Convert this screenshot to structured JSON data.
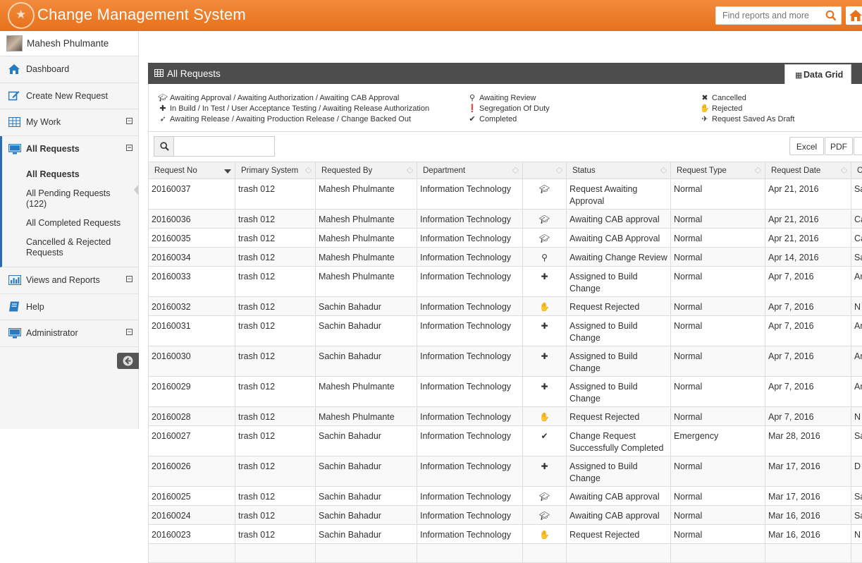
{
  "header": {
    "app_title": "Change Management System",
    "search_placeholder": "Find reports and more"
  },
  "user": {
    "name": "Mahesh Phulmante"
  },
  "sidebar": {
    "items": [
      {
        "label": "Dashboard",
        "icon": "home-icon"
      },
      {
        "label": "Create New Request",
        "icon": "edit-icon"
      },
      {
        "label": "My Work",
        "icon": "table-icon"
      },
      {
        "label": "All Requests",
        "icon": "monitor-icon"
      },
      {
        "label": "Views and Reports",
        "icon": "bar-chart-icon"
      },
      {
        "label": "Help",
        "icon": "book-icon"
      },
      {
        "label": "Administrator",
        "icon": "monitor-icon"
      }
    ],
    "sub_items": [
      "All Requests",
      "All Pending Requests (122)",
      "All Completed Requests",
      "Cancelled & Rejected Requests"
    ]
  },
  "panel": {
    "title": "All Requests",
    "tab_label": "Data Grid"
  },
  "legend": {
    "col1": [
      "Awaiting Approval / Awaiting Authorization / Awaiting CAB Approval",
      "In Build / In Test / User Acceptance Testing / Awaiting Release Authorization",
      "Awaiting Release / Awaiting Production Release / Change Backed Out"
    ],
    "col2": [
      "Awaiting Review",
      "Segregation Of Duty",
      "Completed"
    ],
    "col3": [
      "Cancelled",
      "Rejected",
      "Request Saved As Draft"
    ]
  },
  "toolbar": {
    "excel": "Excel",
    "pdf": "PDF"
  },
  "columns": [
    "Request No",
    "Primary System",
    "Requested By",
    "Department",
    "",
    "Status",
    "Request Type",
    "Request Date",
    "C"
  ],
  "rows": [
    {
      "no": "20160037",
      "system": "trash 012",
      "by": "Mahesh Phulmante",
      "dept": "Information Technology",
      "icon": "approval",
      "status": "Request Awaiting Approval",
      "type": "Normal",
      "date": "Apr 21, 2016",
      "c": "Sa"
    },
    {
      "no": "20160036",
      "system": "trash 012",
      "by": "Mahesh Phulmante",
      "dept": "Information Technology",
      "icon": "approval",
      "status": "Awaiting CAB approval",
      "type": "Normal",
      "date": "Apr 21, 2016",
      "c": "Ca"
    },
    {
      "no": "20160035",
      "system": "trash 012",
      "by": "Mahesh Phulmante",
      "dept": "Information Technology",
      "icon": "approval",
      "status": "Awaiting CAB Approval",
      "type": "Normal",
      "date": "Apr 21, 2016",
      "c": "Ca"
    },
    {
      "no": "20160034",
      "system": "trash 012",
      "by": "Mahesh Phulmante",
      "dept": "Information Technology",
      "icon": "review",
      "status": "Awaiting Change Review",
      "type": "Normal",
      "date": "Apr 14, 2016",
      "c": "Sa"
    },
    {
      "no": "20160033",
      "system": "trash 012",
      "by": "Mahesh Phulmante",
      "dept": "Information Technology",
      "icon": "build",
      "status": "Assigned to Build Change",
      "type": "Normal",
      "date": "Apr 7, 2016",
      "c": "Ar"
    },
    {
      "no": "20160032",
      "system": "trash 012",
      "by": "Sachin Bahadur",
      "dept": "Information Technology",
      "icon": "rejected",
      "status": "Request Rejected",
      "type": "Normal",
      "date": "Apr 7, 2016",
      "c": "N"
    },
    {
      "no": "20160031",
      "system": "trash 012",
      "by": "Sachin Bahadur",
      "dept": "Information Technology",
      "icon": "build",
      "status": "Assigned to Build Change",
      "type": "Normal",
      "date": "Apr 7, 2016",
      "c": "Ar"
    },
    {
      "no": "20160030",
      "system": "trash 012",
      "by": "Sachin Bahadur",
      "dept": "Information Technology",
      "icon": "build",
      "status": "Assigned to Build Change",
      "type": "Normal",
      "date": "Apr 7, 2016",
      "c": "Ar"
    },
    {
      "no": "20160029",
      "system": "trash 012",
      "by": "Mahesh Phulmante",
      "dept": "Information Technology",
      "icon": "build",
      "status": "Assigned to Build Change",
      "type": "Normal",
      "date": "Apr 7, 2016",
      "c": "Ar"
    },
    {
      "no": "20160028",
      "system": "trash 012",
      "by": "Mahesh Phulmante",
      "dept": "Information Technology",
      "icon": "rejected",
      "status": "Request Rejected",
      "type": "Normal",
      "date": "Apr 7, 2016",
      "c": "N"
    },
    {
      "no": "20160027",
      "system": "trash 012",
      "by": "Sachin Bahadur",
      "dept": "Information Technology",
      "icon": "completed",
      "status": "Change Request Successfully Completed",
      "type": "Emergency",
      "date": "Mar 28, 2016",
      "c": "Sa"
    },
    {
      "no": "20160026",
      "system": "trash 012",
      "by": "Sachin Bahadur",
      "dept": "Information Technology",
      "icon": "build",
      "status": "Assigned to Build Change",
      "type": "Normal",
      "date": "Mar 17, 2016",
      "c": "D"
    },
    {
      "no": "20160025",
      "system": "trash 012",
      "by": "Sachin Bahadur",
      "dept": "Information Technology",
      "icon": "approval",
      "status": "Awaiting CAB approval",
      "type": "Normal",
      "date": "Mar 17, 2016",
      "c": "Sa"
    },
    {
      "no": "20160024",
      "system": "trash 012",
      "by": "Sachin Bahadur",
      "dept": "Information Technology",
      "icon": "approval",
      "status": "Awaiting CAB approval",
      "type": "Normal",
      "date": "Mar 16, 2016",
      "c": "Sa"
    },
    {
      "no": "20160023",
      "system": "trash 012",
      "by": "Sachin Bahadur",
      "dept": "Information Technology",
      "icon": "rejected",
      "status": "Request Rejected",
      "type": "Normal",
      "date": "Mar 16, 2016",
      "c": "N"
    }
  ],
  "colors": {
    "topbar": "#ee7f2d",
    "panel_header": "#4d4d4d",
    "active_accent": "#2a6cb3",
    "nav_icon": "#2a7bbf"
  }
}
